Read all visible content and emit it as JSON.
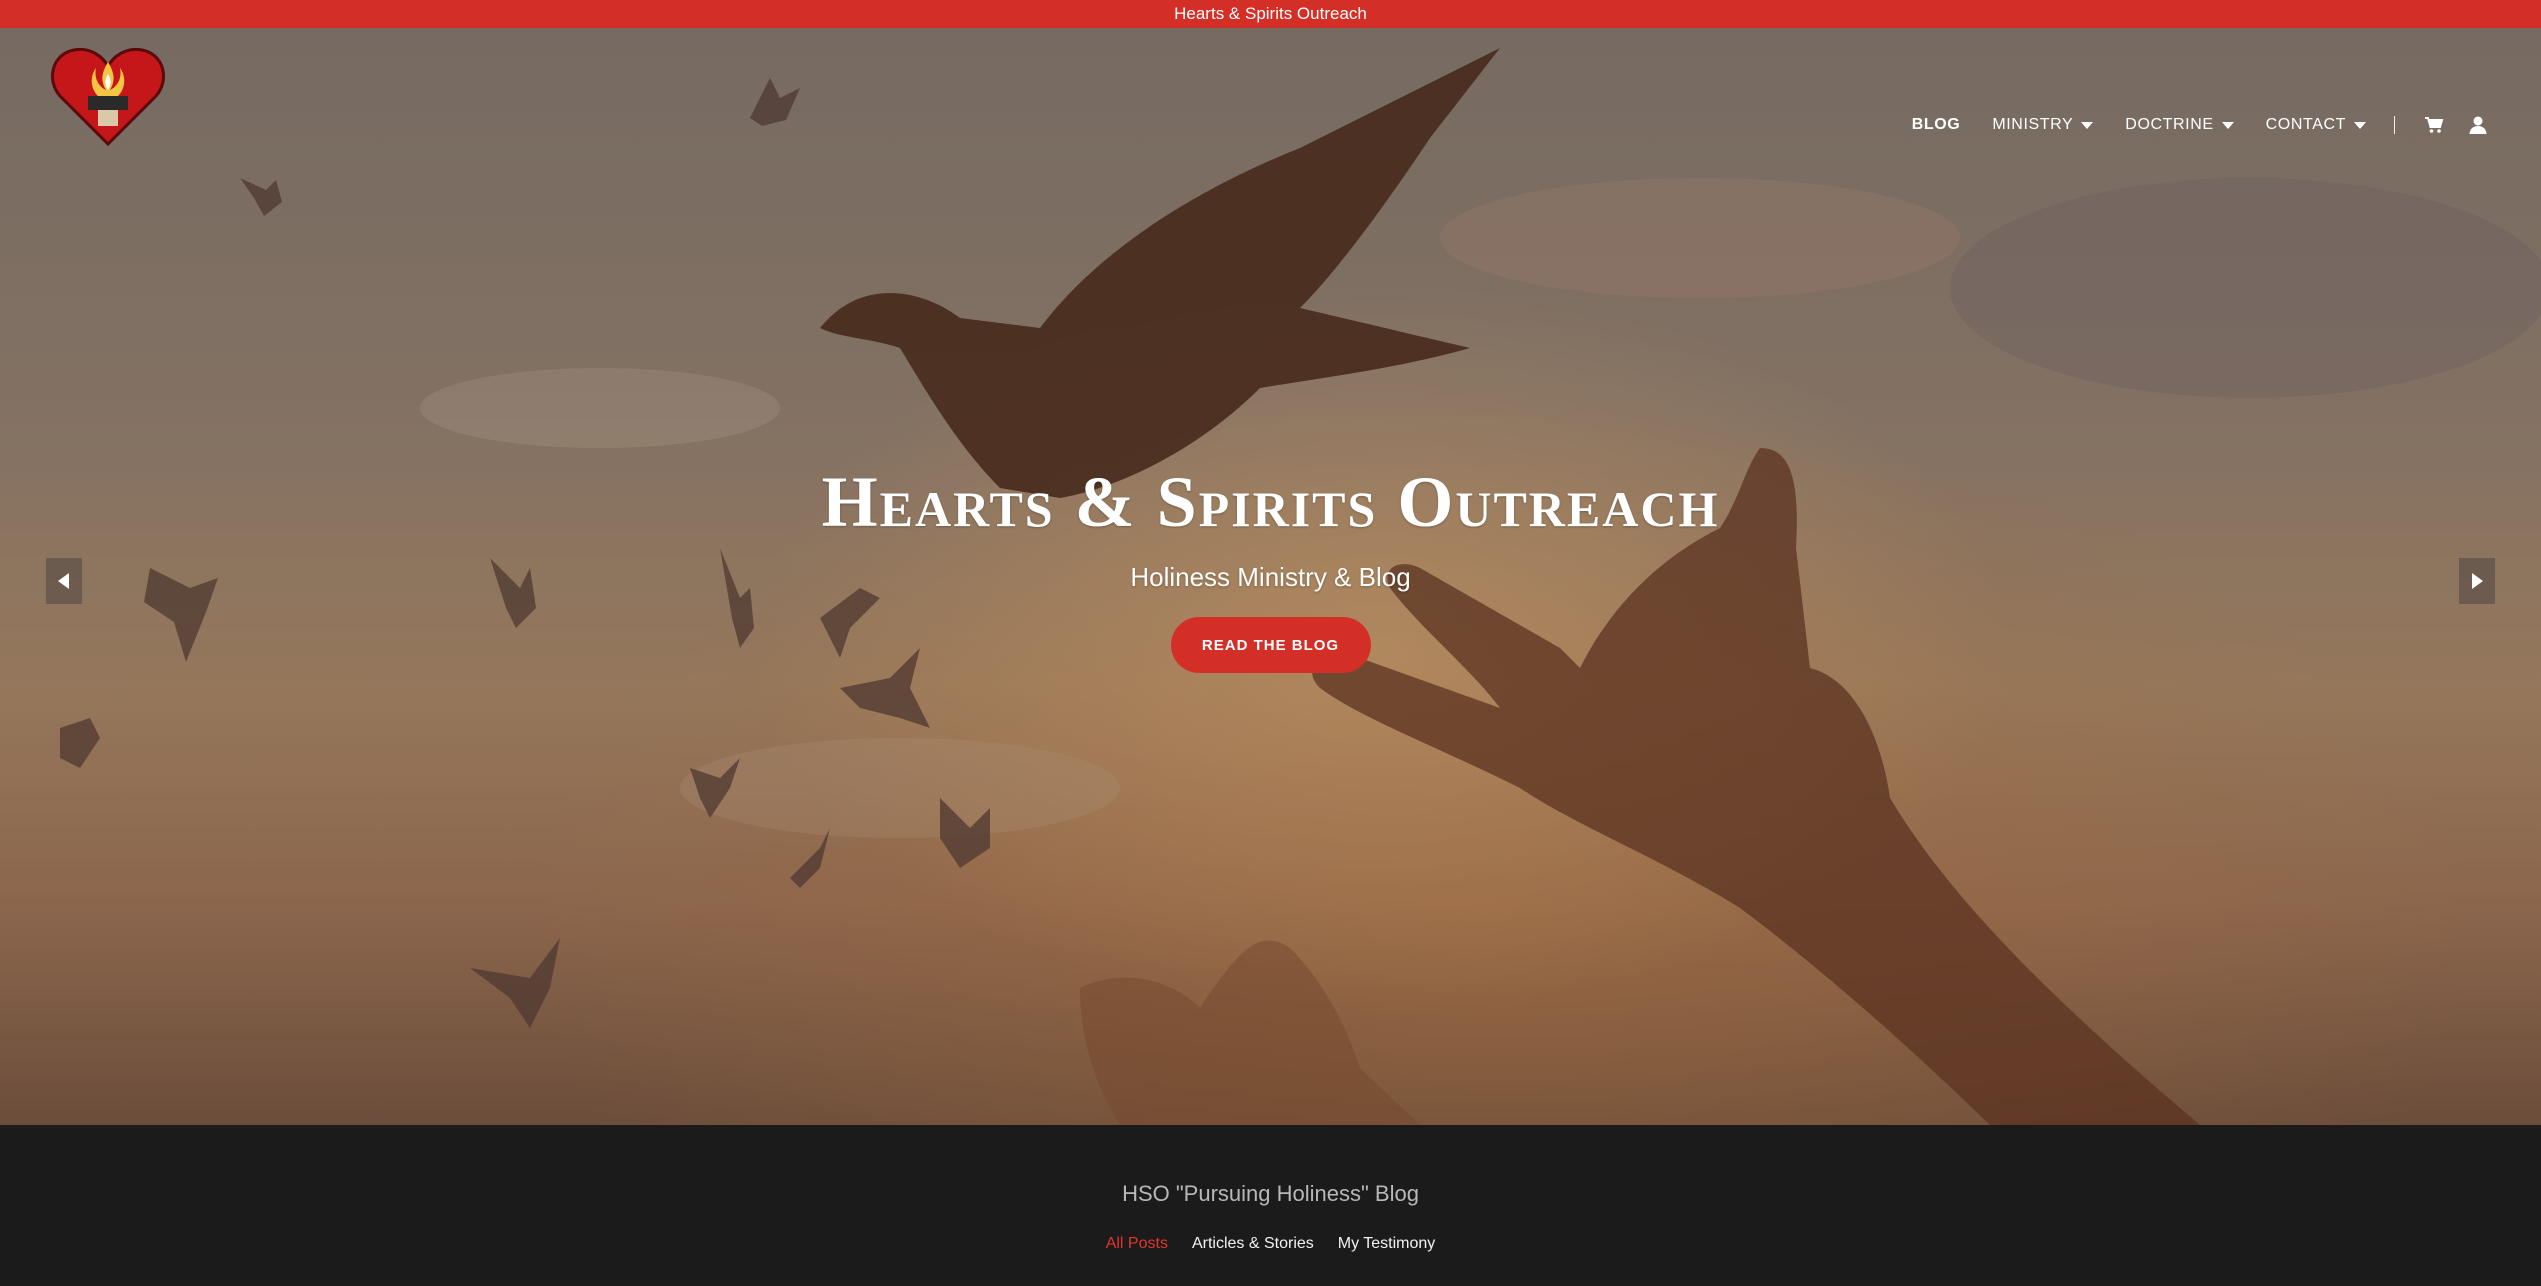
{
  "announcement": {
    "text": "Hearts & Spirits Outreach"
  },
  "nav": {
    "items": [
      {
        "label": "BLOG",
        "active": true,
        "dropdown": false
      },
      {
        "label": "MINISTRY",
        "active": false,
        "dropdown": true
      },
      {
        "label": "DOCTRINE",
        "active": false,
        "dropdown": true
      },
      {
        "label": "CONTACT",
        "active": false,
        "dropdown": true
      }
    ],
    "icons": [
      "cart-icon",
      "account-icon"
    ]
  },
  "hero": {
    "title": "Hearts & Spirits Outreach",
    "subtitle": "Holiness Ministry & Blog",
    "button_label": "READ THE BLOG"
  },
  "slider": {
    "prev_icon": "arrow-left-icon",
    "next_icon": "arrow-right-icon"
  },
  "blog": {
    "title": "HSO \"Pursuing Holiness\" Blog",
    "filters": [
      {
        "label": "All Posts",
        "active": true
      },
      {
        "label": "Articles & Stories",
        "active": false
      },
      {
        "label": "My Testimony",
        "active": false
      }
    ]
  },
  "colors": {
    "accent": "#d42f26",
    "dark_bg": "#1b1b1b",
    "active_filter": "#e2352b"
  }
}
